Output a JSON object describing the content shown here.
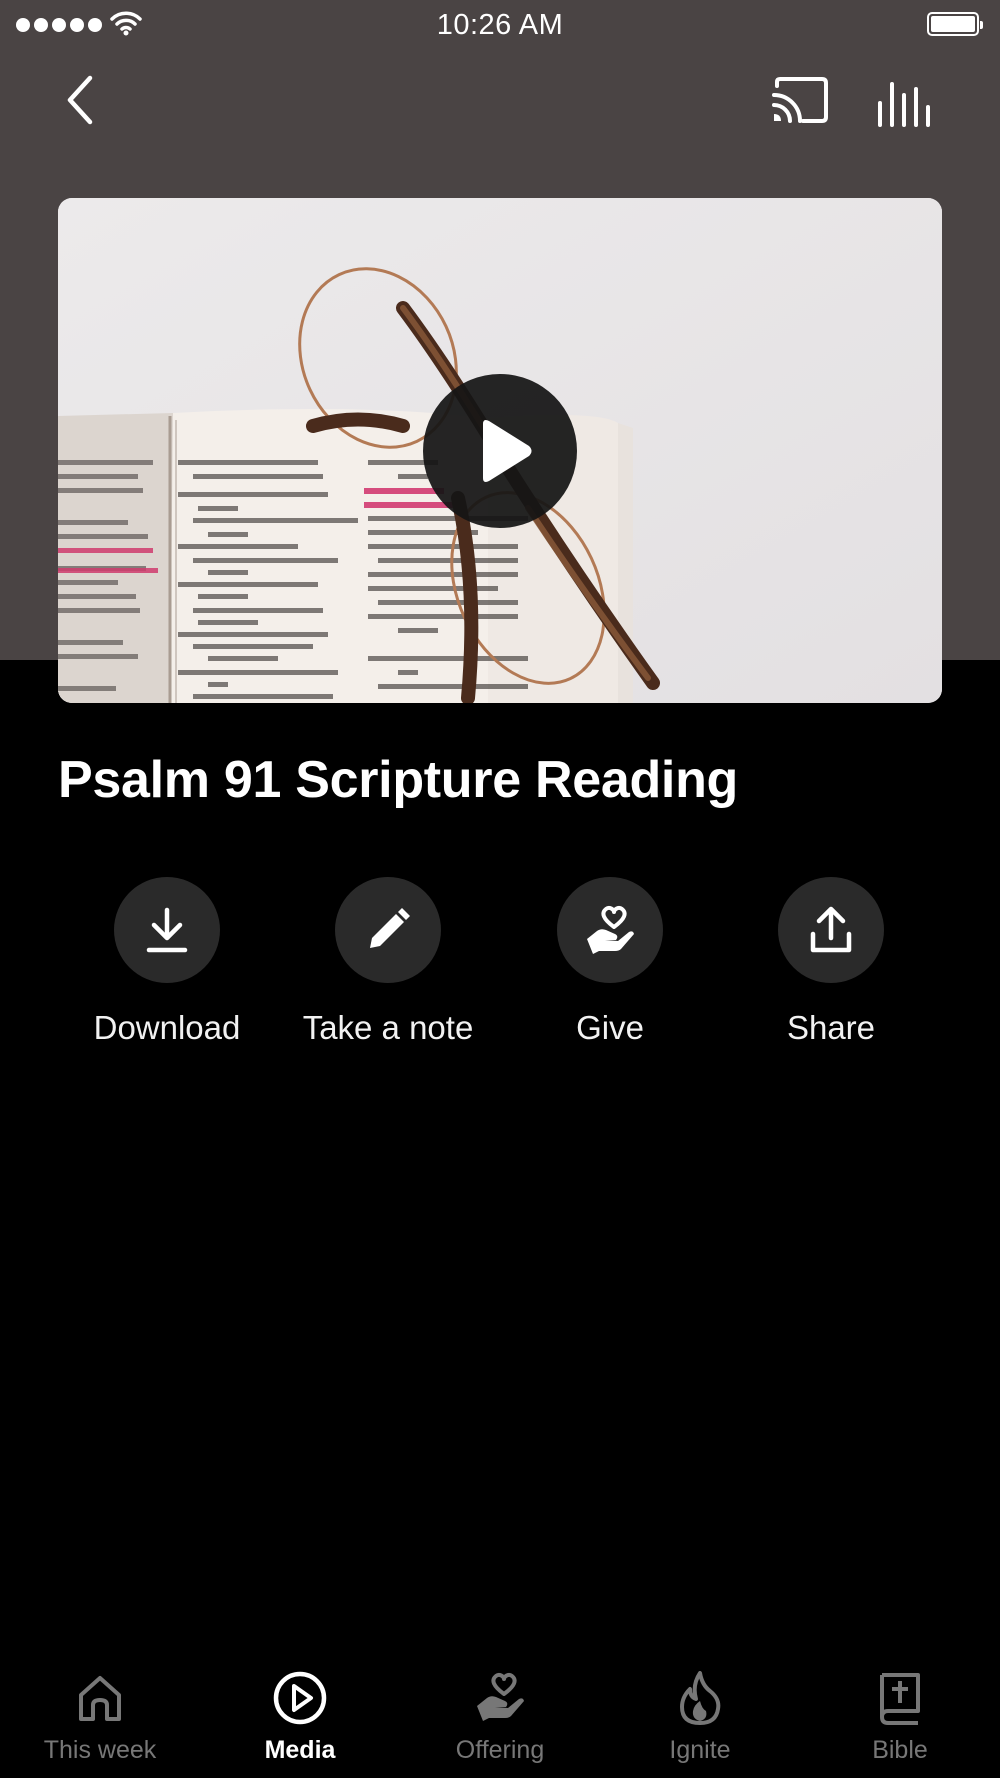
{
  "status_bar": {
    "time": "10:26 AM"
  },
  "player": {
    "title": "Psalm 91 Scripture Reading",
    "thumbnail_icon": "open-bible-with-glasses-image",
    "play_icon": "play-icon"
  },
  "actions": [
    {
      "label": "Download",
      "icon": "download-icon"
    },
    {
      "label": "Take a note",
      "icon": "pencil-icon"
    },
    {
      "label": "Give",
      "icon": "heart-hand-icon"
    },
    {
      "label": "Share",
      "icon": "share-icon"
    }
  ],
  "tabs": [
    {
      "label": "This week",
      "icon": "home-icon",
      "active": false
    },
    {
      "label": "Media",
      "icon": "play-circle-icon",
      "active": true
    },
    {
      "label": "Offering",
      "icon": "heart-hand-icon",
      "active": false
    },
    {
      "label": "Ignite",
      "icon": "flame-icon",
      "active": false
    },
    {
      "label": "Bible",
      "icon": "bible-icon",
      "active": false
    }
  ],
  "colors": {
    "header_background": "#4a4444",
    "page_background": "#000000",
    "action_circle": "#2a2a2a",
    "tab_inactive": "#777777",
    "tab_active": "#ffffff"
  }
}
